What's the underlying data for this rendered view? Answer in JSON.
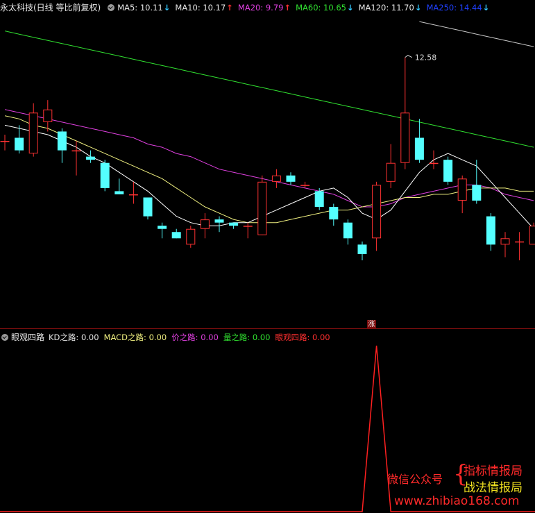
{
  "main_legend": {
    "title": "永太科技(日线 等比前复权)",
    "items": [
      {
        "label": "MA5: 10.11",
        "arrow": "↓",
        "color": "#e6e6e6",
        "arrow_color": "#32c8ff"
      },
      {
        "label": "MA10: 10.17",
        "arrow": "↑",
        "color": "#e6e6e6",
        "arrow_color": "#ff3030"
      },
      {
        "label": "MA20: 9.79",
        "arrow": "↑",
        "color": "#e040e0",
        "arrow_color": "#ff3030"
      },
      {
        "label": "MA60: 10.65",
        "arrow": "↓",
        "color": "#30e030",
        "arrow_color": "#32c8ff"
      },
      {
        "label": "MA120: 11.70",
        "arrow": "↓",
        "color": "#e6e6e6",
        "arrow_color": "#32c8ff"
      },
      {
        "label": "MA250: 14.44",
        "arrow": "↓",
        "color": "#2040ff",
        "arrow_color": "#32c8ff"
      }
    ]
  },
  "sub_legend": {
    "title": "眼观四路",
    "items": [
      {
        "label": "KD之路: 0.00",
        "color": "#e6e6e6"
      },
      {
        "label": "MACD之路: 0.00",
        "color": "#f0f080"
      },
      {
        "label": "价之路: 0.00",
        "color": "#e040e0"
      },
      {
        "label": "量之路: 0.00",
        "color": "#30e030"
      },
      {
        "label": "眼观四路: 0.00",
        "color": "#ff3030"
      }
    ]
  },
  "badge": {
    "label": "涨"
  },
  "watermark": {
    "wechat": "微信公众号",
    "brace": "{",
    "line1": "指标情报局",
    "line2": "战法情报局",
    "site": "www.zhibiao168.com"
  },
  "colors": {
    "up": "#ff3232",
    "down": "#54ffff",
    "ma5": "#ffffff",
    "ma10": "#f0f080",
    "ma20": "#e040e0",
    "ma60": "#30e030",
    "ma120": "#c8c8c8",
    "signal": "#ff2020"
  },
  "chart_data": [
    {
      "type": "candlestick",
      "price_range": [
        8.3,
        13.25
      ],
      "high_label": "12.58",
      "candles": [
        {
          "o": 11.25,
          "c": 11.25,
          "h": 11.35,
          "l": 11.1
        },
        {
          "o": 11.3,
          "c": 11.1,
          "h": 11.5,
          "l": 11.05
        },
        {
          "o": 11.05,
          "c": 11.7,
          "h": 11.85,
          "l": 11.0
        },
        {
          "o": 11.55,
          "c": 11.75,
          "h": 11.9,
          "l": 11.4
        },
        {
          "o": 11.4,
          "c": 11.1,
          "h": 11.45,
          "l": 10.9
        },
        {
          "o": 11.1,
          "c": 11.1,
          "h": 11.25,
          "l": 10.7
        },
        {
          "o": 11.0,
          "c": 10.95,
          "h": 11.1,
          "l": 10.9
        },
        {
          "o": 10.9,
          "c": 10.5,
          "h": 10.95,
          "l": 10.45
        },
        {
          "o": 10.45,
          "c": 10.4,
          "h": 10.65,
          "l": 10.4
        },
        {
          "o": 10.4,
          "c": 10.4,
          "h": 10.6,
          "l": 10.25
        },
        {
          "o": 10.35,
          "c": 10.05,
          "h": 10.35,
          "l": 10.0
        },
        {
          "o": 9.9,
          "c": 9.85,
          "h": 9.95,
          "l": 9.7
        },
        {
          "o": 9.8,
          "c": 9.7,
          "h": 9.85,
          "l": 9.7
        },
        {
          "o": 9.6,
          "c": 9.85,
          "h": 9.9,
          "l": 9.55
        },
        {
          "o": 9.85,
          "c": 10.0,
          "h": 10.1,
          "l": 9.7
        },
        {
          "o": 10.0,
          "c": 9.95,
          "h": 10.05,
          "l": 9.8
        },
        {
          "o": 9.95,
          "c": 9.9,
          "h": 9.95,
          "l": 9.85
        },
        {
          "o": 9.9,
          "c": 9.9,
          "h": 9.95,
          "l": 9.7
        },
        {
          "o": 9.75,
          "c": 10.6,
          "h": 10.7,
          "l": 9.75
        },
        {
          "o": 10.6,
          "c": 10.7,
          "h": 10.8,
          "l": 10.5
        },
        {
          "o": 10.7,
          "c": 10.6,
          "h": 10.75,
          "l": 10.55
        },
        {
          "o": 10.55,
          "c": 10.55,
          "h": 10.6,
          "l": 10.5
        },
        {
          "o": 10.45,
          "c": 10.2,
          "h": 10.5,
          "l": 10.15
        },
        {
          "o": 10.2,
          "c": 10.0,
          "h": 10.25,
          "l": 9.9
        },
        {
          "o": 9.95,
          "c": 9.7,
          "h": 10.0,
          "l": 9.6
        },
        {
          "o": 9.6,
          "c": 9.45,
          "h": 9.65,
          "l": 9.35
        },
        {
          "o": 9.7,
          "c": 10.55,
          "h": 10.6,
          "l": 9.5
        },
        {
          "o": 10.6,
          "c": 10.9,
          "h": 11.2,
          "l": 10.5
        },
        {
          "o": 10.9,
          "c": 11.7,
          "h": 12.58,
          "l": 10.8
        },
        {
          "o": 11.3,
          "c": 10.95,
          "h": 11.6,
          "l": 10.9
        },
        {
          "o": 10.9,
          "c": 10.9,
          "h": 11.1,
          "l": 10.8
        },
        {
          "o": 10.95,
          "c": 10.6,
          "h": 11.0,
          "l": 10.55
        },
        {
          "o": 10.3,
          "c": 10.65,
          "h": 10.7,
          "l": 10.1
        },
        {
          "o": 10.55,
          "c": 10.3,
          "h": 10.95,
          "l": 10.25
        },
        {
          "o": 10.05,
          "c": 9.6,
          "h": 10.1,
          "l": 9.5
        },
        {
          "o": 9.6,
          "c": 9.7,
          "h": 9.8,
          "l": 9.4
        },
        {
          "o": 9.65,
          "c": 9.65,
          "h": 9.8,
          "l": 9.35
        },
        {
          "o": 9.6,
          "c": 9.9,
          "h": 9.95,
          "l": 9.6
        }
      ],
      "ma5": [
        11.5,
        11.45,
        11.4,
        11.35,
        11.25,
        11.15,
        11.0,
        10.9,
        10.75,
        10.6,
        10.45,
        10.25,
        10.05,
        9.95,
        9.9,
        9.9,
        9.95,
        9.95,
        10.05,
        10.15,
        10.25,
        10.35,
        10.45,
        10.5,
        10.35,
        10.1,
        10.0,
        10.15,
        10.45,
        10.75,
        10.95,
        11.05,
        10.95,
        10.85,
        10.6,
        10.35,
        10.1,
        9.85
      ],
      "ma10": [
        11.65,
        11.6,
        11.5,
        11.45,
        11.35,
        11.25,
        11.15,
        11.05,
        10.95,
        10.85,
        10.75,
        10.65,
        10.5,
        10.35,
        10.2,
        10.1,
        10.0,
        9.95,
        9.95,
        9.95,
        10.0,
        10.05,
        10.1,
        10.15,
        10.15,
        10.2,
        10.25,
        10.3,
        10.35,
        10.35,
        10.4,
        10.4,
        10.45,
        10.5,
        10.5,
        10.5,
        10.45,
        10.45
      ],
      "ma20": [
        11.75,
        11.7,
        11.65,
        11.6,
        11.55,
        11.5,
        11.45,
        11.4,
        11.35,
        11.3,
        11.2,
        11.15,
        11.05,
        11.0,
        10.9,
        10.8,
        10.75,
        10.7,
        10.65,
        10.6,
        10.55,
        10.5,
        10.45,
        10.4,
        10.3,
        10.2,
        10.2,
        10.25,
        10.35,
        10.4,
        10.45,
        10.5,
        10.55,
        10.55,
        10.5,
        10.4,
        10.35,
        10.3
      ],
      "ma60": [
        13.0,
        12.95,
        12.9,
        12.85,
        12.8,
        12.75,
        12.7,
        12.65,
        12.6,
        12.55,
        12.5,
        12.45,
        12.4,
        12.35,
        12.3,
        12.25,
        12.2,
        12.15,
        12.1,
        12.05,
        12.0,
        11.95,
        11.9,
        11.85,
        11.8,
        11.75,
        11.7,
        11.65,
        11.6,
        11.55,
        11.5,
        11.45,
        11.4,
        11.35,
        11.3,
        11.25,
        11.2,
        11.15
      ],
      "ma120": [
        null,
        null,
        null,
        null,
        null,
        null,
        null,
        null,
        null,
        null,
        null,
        null,
        null,
        null,
        null,
        null,
        null,
        null,
        null,
        null,
        null,
        null,
        null,
        null,
        null,
        null,
        null,
        null,
        null,
        13.15,
        13.1,
        13.05,
        13.0,
        12.95,
        12.9,
        12.85,
        12.8,
        12.75
      ]
    },
    {
      "type": "line",
      "name": "眼观四路",
      "y_range": [
        0,
        1
      ],
      "values": [
        0,
        0,
        0,
        0,
        0,
        0,
        0,
        0,
        0,
        0,
        0,
        0,
        0,
        0,
        0,
        0,
        0,
        0,
        0,
        0,
        0,
        0,
        0,
        0,
        0,
        0,
        1,
        0,
        0,
        0,
        0,
        0,
        0,
        0,
        0,
        0,
        0,
        0
      ]
    }
  ]
}
